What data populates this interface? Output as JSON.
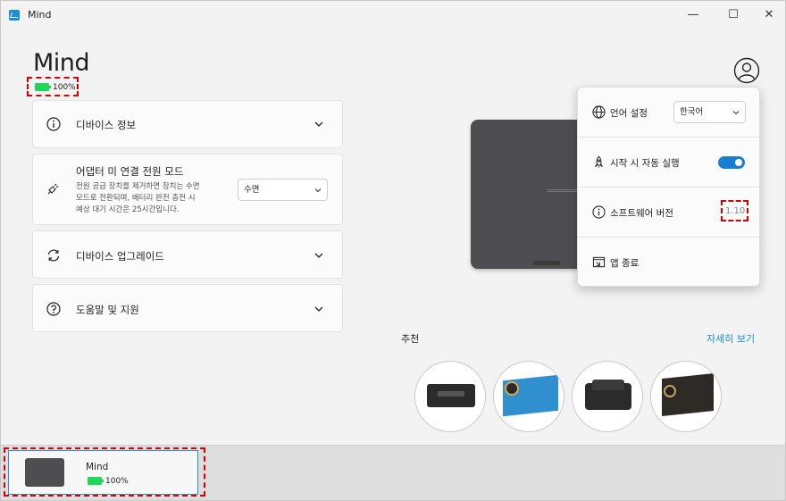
{
  "window": {
    "title": "Mind",
    "controls": [
      "—",
      "☐",
      "✕"
    ]
  },
  "header": {
    "title": "Mind",
    "battery": "100%"
  },
  "panels": {
    "device_info": "디바이스 정보",
    "power_mode": {
      "label": "어댑터 미 연결 전원 모드",
      "desc_1": "전원 공급 장치를 제거하면 장치는 수면",
      "desc_2": "모드로 전환되며, 배터리 완전 충전 시",
      "desc_3": "예상 대기 시간은 25시간입니다.",
      "select_value": "수면"
    },
    "upgrade": "디바이스 업그레이드",
    "help": "도움말 및 지원"
  },
  "popup": {
    "language_label": "언어 설정",
    "language_value": "한국어",
    "autostart_label": "시작 시 자동 실행",
    "autostart_on": true,
    "version_label": "소프트웨어 버전",
    "version_value": "1.10",
    "exit_label": "앱 종료"
  },
  "recommend": {
    "title": "추천",
    "more": "자세히 보기"
  },
  "device_bar": {
    "name": "Mind",
    "battery": "100%"
  },
  "colors": {
    "accent": "#1a8fd8",
    "battery": "#1fd65a",
    "highlight": "#d40000"
  }
}
